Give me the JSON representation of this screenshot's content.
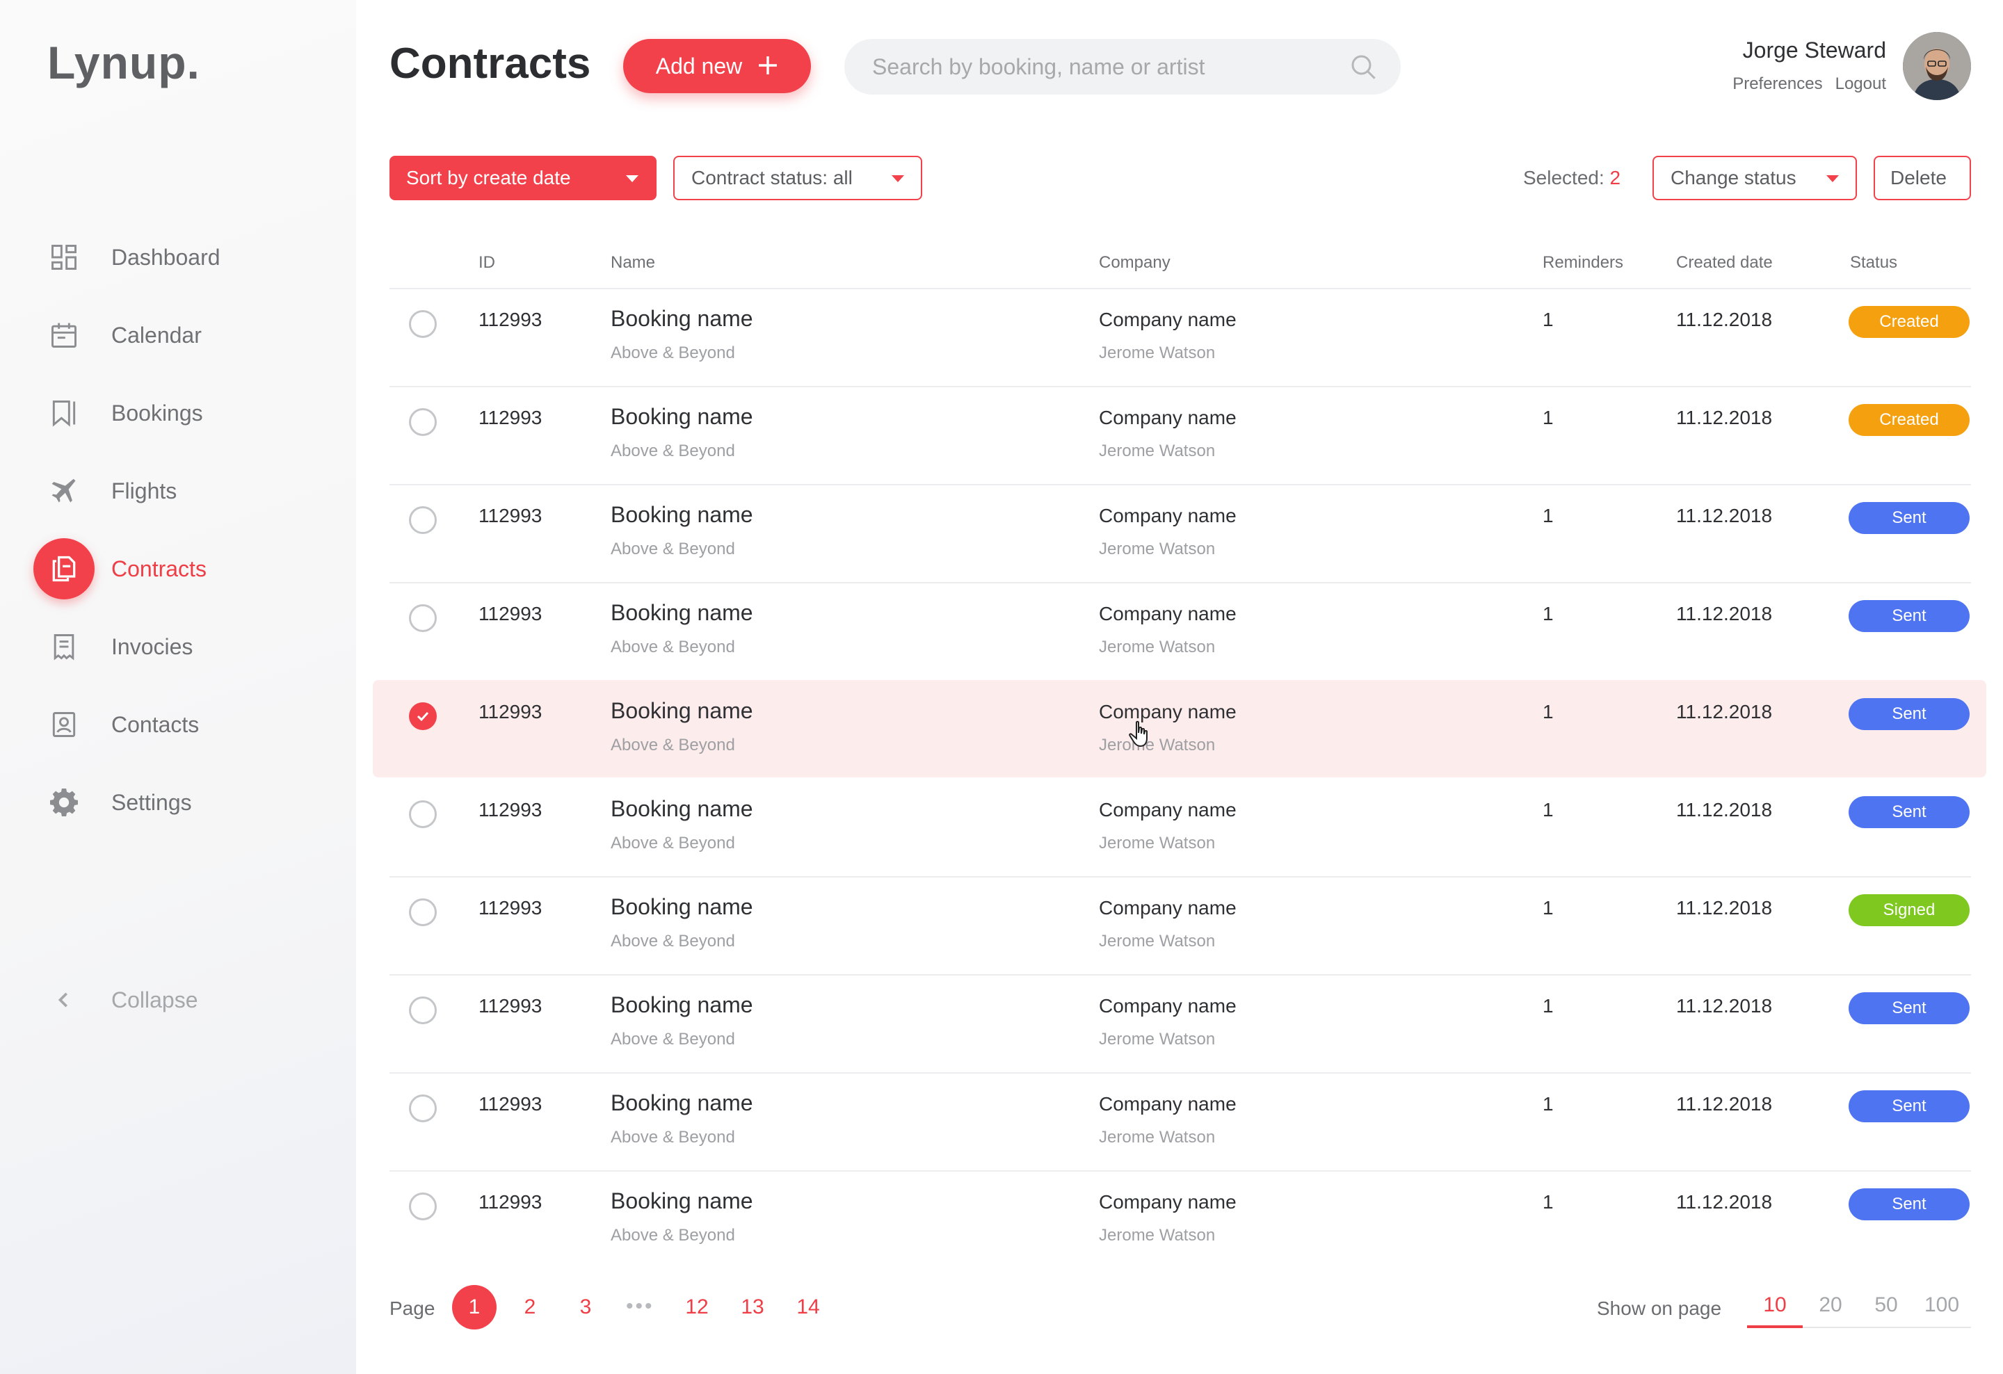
{
  "app": {
    "logo": "Lynup."
  },
  "sidebar": {
    "items": [
      {
        "label": "Dashboard",
        "icon": "dashboard-icon"
      },
      {
        "label": "Calendar",
        "icon": "calendar-icon"
      },
      {
        "label": "Bookings",
        "icon": "bookmark-icon"
      },
      {
        "label": "Flights",
        "icon": "plane-icon"
      },
      {
        "label": "Contracts",
        "icon": "document-icon",
        "active": true
      },
      {
        "label": "Invocies",
        "icon": "invoice-icon"
      },
      {
        "label": "Contacts",
        "icon": "contact-icon"
      },
      {
        "label": "Settings",
        "icon": "gear-icon"
      }
    ],
    "collapse_label": "Collapse"
  },
  "header": {
    "title": "Contracts",
    "add_label": "Add new",
    "search_placeholder": "Search by booking, name or artist",
    "search_value": "",
    "user_name": "Jorge Steward",
    "preferences_label": "Preferences",
    "logout_label": "Logout"
  },
  "toolbar": {
    "sort_label": "Sort by create date",
    "status_filter_label": "Contract status: all",
    "selected_label": "Selected:",
    "selected_count": "2",
    "change_status_label": "Change status",
    "delete_label": "Delete"
  },
  "table": {
    "columns": [
      "ID",
      "Name",
      "Company",
      "Reminders",
      "Created date",
      "Status"
    ],
    "rows": [
      {
        "id": "112993",
        "name": "Booking name",
        "artist": "Above & Beyond",
        "company": "Company name",
        "contact": "Jerome Watson",
        "reminders": "1",
        "date": "11.12.2018",
        "status": "Created",
        "selected": false
      },
      {
        "id": "112993",
        "name": "Booking name",
        "artist": "Above & Beyond",
        "company": "Company name",
        "contact": "Jerome Watson",
        "reminders": "1",
        "date": "11.12.2018",
        "status": "Created",
        "selected": false
      },
      {
        "id": "112993",
        "name": "Booking name",
        "artist": "Above & Beyond",
        "company": "Company name",
        "contact": "Jerome Watson",
        "reminders": "1",
        "date": "11.12.2018",
        "status": "Sent",
        "selected": false
      },
      {
        "id": "112993",
        "name": "Booking name",
        "artist": "Above & Beyond",
        "company": "Company name",
        "contact": "Jerome Watson",
        "reminders": "1",
        "date": "11.12.2018",
        "status": "Sent",
        "selected": false
      },
      {
        "id": "112993",
        "name": "Booking name",
        "artist": "Above & Beyond",
        "company": "Company name",
        "contact": "Jerome Watson",
        "reminders": "1",
        "date": "11.12.2018",
        "status": "Sent",
        "selected": true
      },
      {
        "id": "112993",
        "name": "Booking name",
        "artist": "Above & Beyond",
        "company": "Company name",
        "contact": "Jerome Watson",
        "reminders": "1",
        "date": "11.12.2018",
        "status": "Sent",
        "selected": false
      },
      {
        "id": "112993",
        "name": "Booking name",
        "artist": "Above & Beyond",
        "company": "Company name",
        "contact": "Jerome Watson",
        "reminders": "1",
        "date": "11.12.2018",
        "status": "Signed",
        "selected": false
      },
      {
        "id": "112993",
        "name": "Booking name",
        "artist": "Above & Beyond",
        "company": "Company name",
        "contact": "Jerome Watson",
        "reminders": "1",
        "date": "11.12.2018",
        "status": "Sent",
        "selected": false
      },
      {
        "id": "112993",
        "name": "Booking name",
        "artist": "Above & Beyond",
        "company": "Company name",
        "contact": "Jerome Watson",
        "reminders": "1",
        "date": "11.12.2018",
        "status": "Sent",
        "selected": false
      },
      {
        "id": "112993",
        "name": "Booking name",
        "artist": "Above & Beyond",
        "company": "Company name",
        "contact": "Jerome Watson",
        "reminders": "1",
        "date": "11.12.2018",
        "status": "Sent",
        "selected": false
      }
    ]
  },
  "status_colors": {
    "Created": "#f5a00f",
    "Sent": "#4e74f2",
    "Signed": "#7ec81f"
  },
  "colors": {
    "accent": "#f2414a",
    "selected_row": "#fdecec"
  },
  "pagination": {
    "page_label": "Page",
    "pages": [
      "1",
      "2",
      "3",
      "12",
      "13",
      "14"
    ],
    "current": "1",
    "ellipsis": "•••",
    "show_label": "Show on page",
    "show_options": [
      "10",
      "20",
      "50",
      "100"
    ],
    "show_selected": "10"
  }
}
